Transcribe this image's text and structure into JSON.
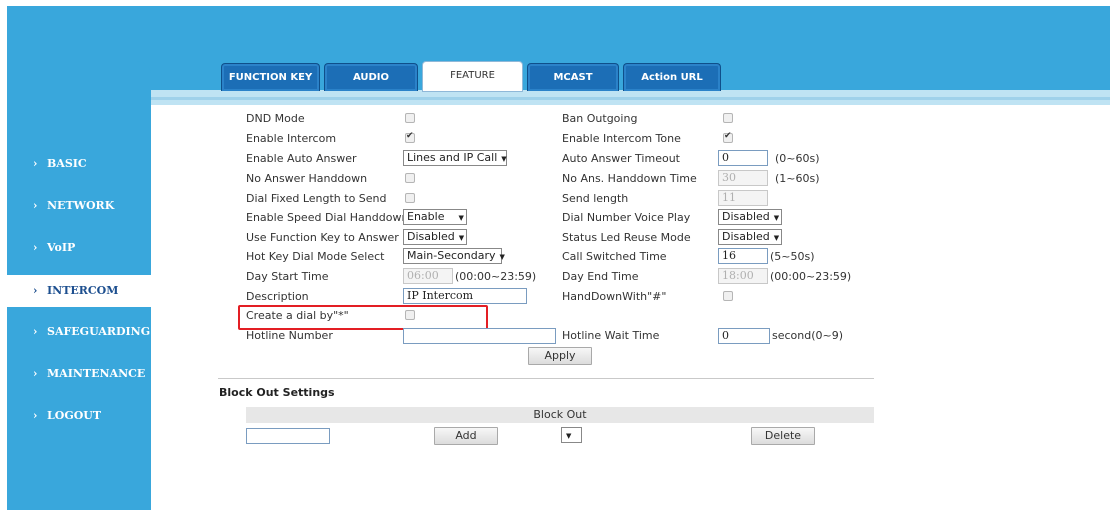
{
  "sidebar": {
    "items": [
      {
        "label": "BASIC",
        "chevron": "›"
      },
      {
        "label": "NETWORK",
        "chevron": "›"
      },
      {
        "label": "VoIP",
        "chevron": "›"
      },
      {
        "label": "INTERCOM",
        "chevron": "›"
      },
      {
        "label": "SAFEGUARDING",
        "chevron": "›"
      },
      {
        "label": "MAINTENANCE",
        "chevron": "›"
      },
      {
        "label": "LOGOUT",
        "chevron": "›"
      }
    ],
    "active": "INTERCOM"
  },
  "tabs": [
    {
      "label": "FUNCTION KEY"
    },
    {
      "label": "AUDIO"
    },
    {
      "label": "FEATURE"
    },
    {
      "label": "MCAST"
    },
    {
      "label": "Action URL"
    }
  ],
  "active_tab": "FEATURE",
  "form": {
    "dnd_mode": {
      "label": "DND Mode",
      "checked": false
    },
    "ban_outgoing": {
      "label": "Ban Outgoing",
      "checked": false
    },
    "enable_intercom": {
      "label": "Enable Intercom",
      "checked": true
    },
    "enable_intercom_tone": {
      "label": "Enable Intercom Tone",
      "checked": true
    },
    "enable_auto_answer": {
      "label": "Enable Auto Answer",
      "value": "Lines and IP Call"
    },
    "auto_answer_timeout": {
      "label": "Auto Answer Timeout",
      "value": "0",
      "unit": "(0~60s)"
    },
    "no_answer_handdown": {
      "label": "No Answer Handdown",
      "checked": false
    },
    "no_ans_handdown_time": {
      "label": "No Ans. Handdown Time",
      "value": "30",
      "unit": "(1~60s)"
    },
    "dial_fixed_length": {
      "label": "Dial Fixed Length to Send",
      "checked": false
    },
    "send_length": {
      "label": "Send length",
      "value": "11"
    },
    "speed_dial_handdown": {
      "label": "Enable Speed Dial Handdown",
      "value": "Enable"
    },
    "dial_number_voice_play": {
      "label": "Dial Number Voice Play",
      "value": "Disabled"
    },
    "function_key_answer": {
      "label": "Use Function Key to Answer",
      "value": "Disabled"
    },
    "status_led_reuse": {
      "label": "Status Led Reuse Mode",
      "value": "Disabled"
    },
    "hotkey_dial_mode": {
      "label": "Hot Key Dial Mode Select",
      "value": "Main-Secondary"
    },
    "call_switched_time": {
      "label": "Call Switched Time",
      "value": "16",
      "unit": "(5~50s)"
    },
    "day_start_time": {
      "label": "Day Start Time",
      "value": "06:00",
      "unit": "(00:00~23:59)"
    },
    "day_end_time": {
      "label": "Day End Time",
      "value": "18:00",
      "unit": "(00:00~23:59)"
    },
    "description": {
      "label": "Description",
      "value": "IP Intercom"
    },
    "handdown_with_hash": {
      "label": "HandDownWith\"#\"",
      "checked": false
    },
    "create_dial_star": {
      "label": "Create a dial by\"*\"",
      "checked": false
    },
    "hotline_number": {
      "label": "Hotline Number",
      "value": ""
    },
    "hotline_wait_time": {
      "label": "Hotline Wait Time",
      "value": "0",
      "unit": "second(0~9)"
    },
    "apply_label": "Apply"
  },
  "block_out": {
    "title": "Block Out Settings",
    "column": "Block Out",
    "input_value": "",
    "add_label": "Add",
    "select_value": "",
    "delete_label": "Delete"
  },
  "colors": {
    "header": "#39a7dc",
    "tab": "#1c6eb6",
    "highlight": "#e31e24"
  }
}
